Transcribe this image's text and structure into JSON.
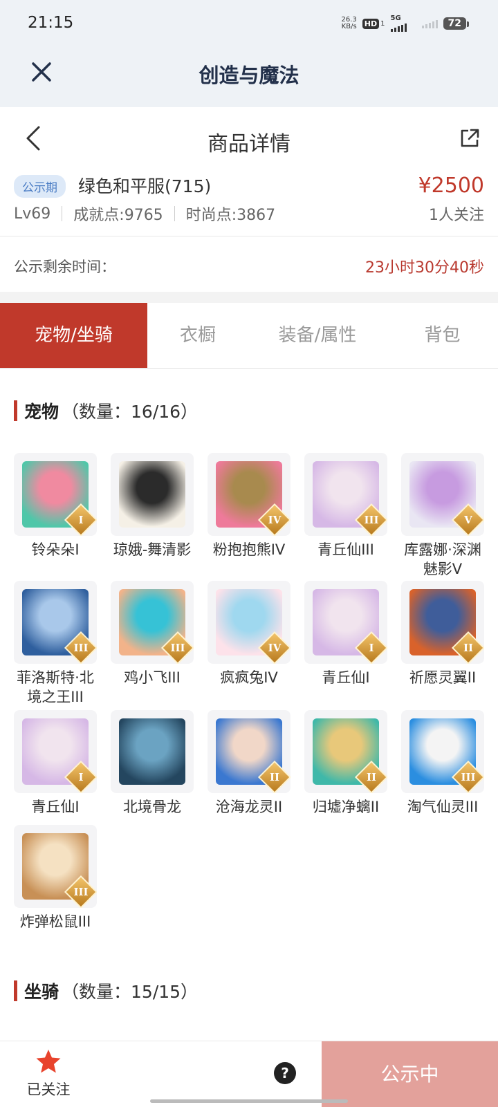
{
  "status": {
    "time": "21:15",
    "net_speed_top": "26.3",
    "net_speed_unit": "KB/s",
    "hd": "HD",
    "sim_index": "1",
    "network": "5G",
    "battery": "72"
  },
  "app_bar": {
    "title": "创造与魔法"
  },
  "nav": {
    "title": "商品详情"
  },
  "summary": {
    "badge": "公示期",
    "item_name": "绿色和平服(715)",
    "price": "¥2500",
    "level": "Lv69",
    "achievement": "成就点:9765",
    "fashion": "时尚点:3867",
    "followers": "1人关注"
  },
  "timer": {
    "label": "公示剩余时间：",
    "value": "23小时30分40秒"
  },
  "tabs": [
    "宠物/坐骑",
    "衣橱",
    "装备/属性",
    "背包"
  ],
  "pets_section": {
    "title": "宠物",
    "count": "（数量：16/16）"
  },
  "mounts_section": {
    "title": "坐骑",
    "count": "（数量：15/15）"
  },
  "pets": [
    {
      "name": "铃朵朵I",
      "rank": "I",
      "colors": [
        "#4fc7a9",
        "#f08aa0"
      ]
    },
    {
      "name": "琼娥-舞清影",
      "rank": "",
      "colors": [
        "#f5f0e6",
        "#2b2b2b"
      ]
    },
    {
      "name": "粉抱抱熊IV",
      "rank": "IV",
      "colors": [
        "#ee7a9a",
        "#a88a4e"
      ]
    },
    {
      "name": "青丘仙III",
      "rank": "III",
      "colors": [
        "#d6b8e6",
        "#f1e4ee"
      ]
    },
    {
      "name": "库露娜·深渊魅影V",
      "rank": "V",
      "colors": [
        "#e9e6f3",
        "#c79be0"
      ]
    },
    {
      "name": "菲洛斯特·北境之王III",
      "rank": "III",
      "colors": [
        "#2f5f9e",
        "#a9c8ea"
      ]
    },
    {
      "name": "鸡小飞III",
      "rank": "III",
      "colors": [
        "#f2b38a",
        "#36c2d6"
      ]
    },
    {
      "name": "疯疯兔IV",
      "rank": "IV",
      "colors": [
        "#fde2ea",
        "#9fd8ef"
      ]
    },
    {
      "name": "青丘仙I",
      "rank": "I",
      "colors": [
        "#d6b8e6",
        "#f1e4ee"
      ]
    },
    {
      "name": "祈愿灵翼II",
      "rank": "II",
      "colors": [
        "#d9622b",
        "#3f5d9a"
      ]
    },
    {
      "name": "青丘仙I",
      "rank": "I",
      "colors": [
        "#d6b8e6",
        "#f1e4ee"
      ]
    },
    {
      "name": "北境骨龙",
      "rank": "",
      "colors": [
        "#24465f",
        "#6ba3c2"
      ]
    },
    {
      "name": "沧海龙灵II",
      "rank": "II",
      "colors": [
        "#3b78d0",
        "#f1d7c8"
      ]
    },
    {
      "name": "归墟净螭II",
      "rank": "II",
      "colors": [
        "#3fb8a9",
        "#e8c87a"
      ]
    },
    {
      "name": "淘气仙灵III",
      "rank": "III",
      "colors": [
        "#2b8ee0",
        "#f4f4f4"
      ]
    },
    {
      "name": "炸弹松鼠III",
      "rank": "III",
      "colors": [
        "#c89056",
        "#f5e1c2"
      ]
    }
  ],
  "bottom": {
    "follow_label": "已关注",
    "help": "?",
    "cta": "公示中"
  },
  "icons": {
    "close": "close-icon",
    "back": "back-icon",
    "share": "share-icon",
    "star": "star-icon",
    "help": "help-icon"
  },
  "colors": {
    "accent": "#c0392b",
    "cta_disabled": "#e3a19b",
    "star": "#e8432c"
  }
}
